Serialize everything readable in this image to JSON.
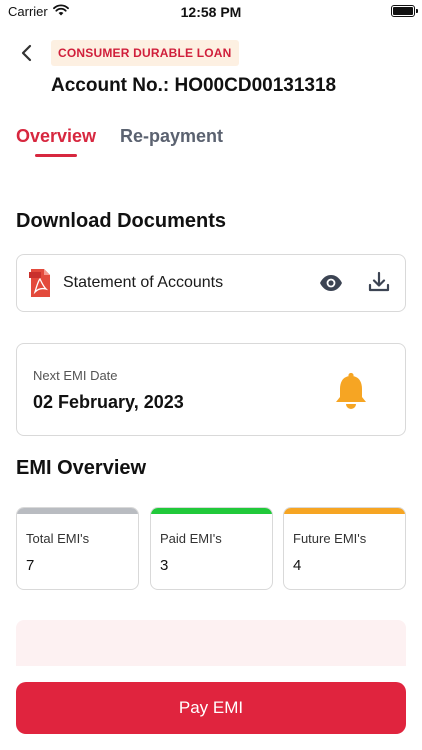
{
  "status_bar": {
    "carrier": "Carrier",
    "time": "12:58 PM"
  },
  "header": {
    "loan_type": "CONSUMER DURABLE LOAN",
    "account_label": "Account No.: HO00CD00131318"
  },
  "tabs": [
    {
      "label": "Overview",
      "active": true
    },
    {
      "label": "Re-payment",
      "active": false
    }
  ],
  "download_documents": {
    "title": "Download Documents",
    "items": [
      {
        "label": "Statement of Accounts",
        "icon": "pdf-icon",
        "actions": [
          "eye-icon",
          "download-icon"
        ]
      }
    ]
  },
  "next_emi": {
    "label": "Next EMI Date",
    "value": "02 February, 2023",
    "icon": "bell-icon"
  },
  "emi_overview": {
    "title": "EMI Overview",
    "stats": [
      {
        "label": "Total EMI's",
        "value": "7",
        "color": "#b9bcc1"
      },
      {
        "label": "Paid EMI's",
        "value": "3",
        "color": "#21c93a"
      },
      {
        "label": "Future EMI's",
        "value": "4",
        "color": "#f6a523"
      }
    ]
  },
  "pay_button": {
    "label": "Pay EMI",
    "color": "#e0243e"
  },
  "colors": {
    "accent": "#d7273f",
    "badge_bg": "#fdf0e2",
    "bell": "#f6a523"
  }
}
